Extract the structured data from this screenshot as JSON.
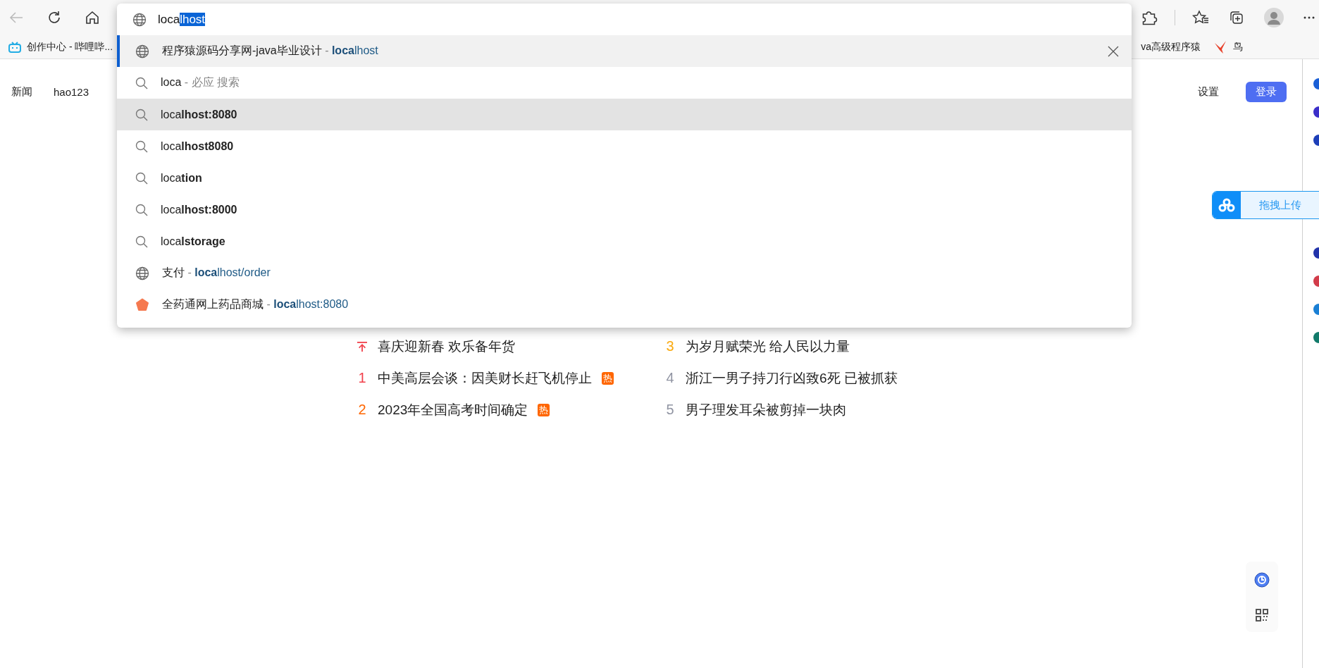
{
  "toolbar": {
    "back": {
      "disabled": true
    }
  },
  "address_bar": {
    "typed": "loca",
    "completion": "lhost"
  },
  "suggestions": [
    {
      "kind": "site",
      "title": "程序猿源码分享网-java毕业设计",
      "sep": "-",
      "url": "**loca**lhost",
      "selected": true,
      "hovered": false
    },
    {
      "kind": "search",
      "text": "loca",
      "sep": "-",
      "hint": "必应 搜索",
      "selected": false,
      "hovered": false
    },
    {
      "kind": "search",
      "text": "loca**lhost:8080**",
      "selected": false,
      "hovered": true
    },
    {
      "kind": "search",
      "text": "loca**lhost8080**",
      "selected": false,
      "hovered": false
    },
    {
      "kind": "search",
      "text": "loca**tion**",
      "selected": false,
      "hovered": false
    },
    {
      "kind": "search",
      "text": "loca**lhost:8000**",
      "selected": false,
      "hovered": false
    },
    {
      "kind": "search",
      "text": "loca**lstorage**",
      "selected": false,
      "hovered": false
    },
    {
      "kind": "site",
      "title": "支付",
      "sep": "-",
      "url": "**loca**lhost/order",
      "selected": false,
      "hovered": false
    },
    {
      "kind": "favicon",
      "title": "全药通网上药品商城",
      "sep": "-",
      "url": "**loca**lhost:8080",
      "selected": false,
      "hovered": false
    }
  ],
  "bookmarks": [
    {
      "kind": "tv",
      "label": "创作中心 - 哔哩哔..."
    },
    {
      "kind": "plain",
      "label": "va高级程序猿"
    },
    {
      "kind": "bird",
      "label": "鸟"
    }
  ],
  "page": {
    "nav_left": [
      "新闻",
      "hao123"
    ],
    "settings": "设置",
    "login": "登录",
    "hot_list": [
      {
        "kind": "pinned",
        "color": "#f1404b",
        "text": "喜庆迎新春 欢乐备年货",
        "hot": false
      },
      {
        "kind": "ranked",
        "rank": "1",
        "color": "#f1404b",
        "text": "中美高层会谈：因美财长赶飞机停止",
        "hot": true,
        "badge": "热"
      },
      {
        "kind": "ranked",
        "rank": "2",
        "color": "#ff6600",
        "text": "2023年全国高考时间确定",
        "hot": true,
        "badge": "热"
      },
      {
        "kind": "ranked",
        "rank": "3",
        "color": "#faa90e",
        "text": "为岁月赋荣光 给人民以力量",
        "hot": false
      },
      {
        "kind": "ranked",
        "rank": "4",
        "color": "#9195a3",
        "text": "浙江一男子持刀行凶致6死 已被抓获",
        "hot": false
      },
      {
        "kind": "ranked",
        "rank": "5",
        "color": "#9195a3",
        "text": "男子理发耳朵被剪掉一块肉",
        "hot": false
      }
    ]
  },
  "upload_widget": {
    "label": "拖拽上传"
  }
}
